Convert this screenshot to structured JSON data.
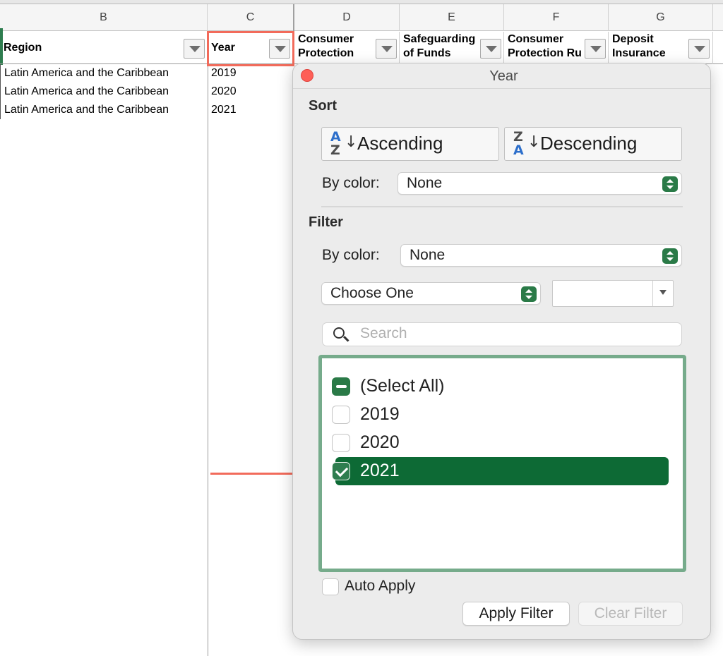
{
  "columns": {
    "letters": [
      "B",
      "C",
      "D",
      "E",
      "F",
      "G"
    ]
  },
  "headers": {
    "region": "Region",
    "year": "Year",
    "consumer_protection": "Consumer Protection",
    "safeguarding": "Safeguarding of Funds",
    "consumer_protection_rules": "Consumer Protection Ru",
    "deposit_insurance": "Deposit Insurance"
  },
  "rows": [
    {
      "region": "Latin America and the Caribbean",
      "year": "2019"
    },
    {
      "region": "Latin America and the Caribbean",
      "year": "2020"
    },
    {
      "region": "Latin America and the Caribbean",
      "year": "2021"
    }
  ],
  "popover": {
    "title": "Year",
    "sort_title": "Sort",
    "ascending_label": "Ascending",
    "descending_label": "Descending",
    "sort_by_color_label": "By color:",
    "sort_by_color_value": "None",
    "filter_title": "Filter",
    "filter_by_color_label": "By color:",
    "filter_by_color_value": "None",
    "condition_value": "Choose One",
    "condition_input_value": "",
    "search_placeholder": "Search",
    "list": {
      "select_all": "(Select All)",
      "items": [
        {
          "label": "2019",
          "checked": false
        },
        {
          "label": "2020",
          "checked": false
        },
        {
          "label": "2021",
          "checked": true
        }
      ]
    },
    "auto_apply_label": "Auto Apply",
    "apply_label": "Apply Filter",
    "clear_label": "Clear Filter"
  },
  "colors": {
    "accent_green": "#2a7a47",
    "selected_row": "#0d6a35",
    "listbox_border": "#76ab8b",
    "annotation_red": "#f26b5b",
    "close_button": "#fe5f57"
  }
}
